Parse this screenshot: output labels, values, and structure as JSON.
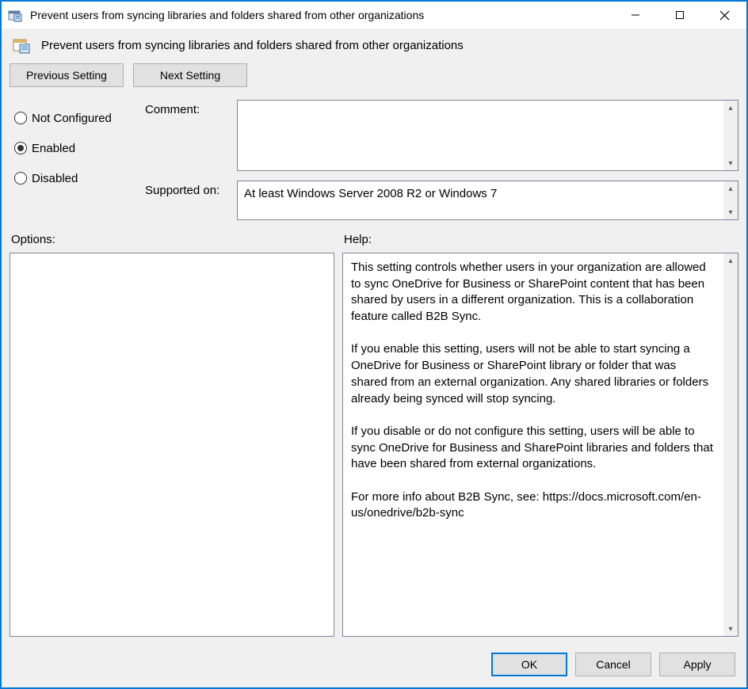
{
  "window": {
    "title": "Prevent users from syncing libraries and folders shared from other organizations"
  },
  "header": {
    "policy_title": "Prevent users from syncing libraries and folders shared from other organizations"
  },
  "nav": {
    "previous": "Previous Setting",
    "next": "Next Setting"
  },
  "state": {
    "selected": "enabled",
    "options": {
      "not_configured": "Not Configured",
      "enabled": "Enabled",
      "disabled": "Disabled"
    }
  },
  "fields": {
    "comment_label": "Comment:",
    "comment_value": "",
    "supported_label": "Supported on:",
    "supported_value": "At least Windows Server 2008 R2 or Windows 7"
  },
  "sections": {
    "options_label": "Options:",
    "help_label": "Help:"
  },
  "options_panel": "",
  "help_text": "This setting controls whether users in your organization are allowed to sync OneDrive for Business or SharePoint content that has been shared by users in a different organization. This is a collaboration feature called B2B Sync.\n\nIf you enable this setting, users will not be able to start syncing a OneDrive for Business or SharePoint library or folder that was shared from an external organization. Any shared libraries or folders already being synced will stop syncing.\n\nIf you disable or do not configure this setting, users will be able to sync OneDrive for Business and SharePoint libraries and folders that have been shared from external organizations.\n\nFor more info about B2B Sync, see: https://docs.microsoft.com/en-us/onedrive/b2b-sync",
  "footer": {
    "ok": "OK",
    "cancel": "Cancel",
    "apply": "Apply"
  }
}
